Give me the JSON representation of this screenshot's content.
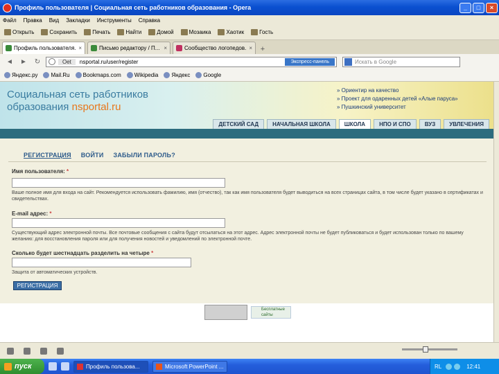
{
  "window": {
    "title": "Профиль пользователя | Социальная сеть работников образования - Opera",
    "min": "_",
    "max": "□",
    "close": "×"
  },
  "menu": [
    "Файл",
    "Правка",
    "Вид",
    "Закладки",
    "Инструменты",
    "Справка"
  ],
  "toolbar": [
    "Открыть",
    "Сохранить",
    "Печать",
    "Найти",
    "Домой",
    "Мозаика",
    "Хаотик",
    "Гость"
  ],
  "tabs": [
    {
      "label": "Профиль пользователя...",
      "close": "×"
    },
    {
      "label": "Письмо редактору / П...",
      "close": "×"
    },
    {
      "label": "Сообщество логопедов...",
      "close": "×"
    }
  ],
  "newtab": "+",
  "address": {
    "back": "◄",
    "forward": "►",
    "reload": "↻",
    "site": "Oet",
    "url": "nsportal.ru/user/register",
    "speed_dial": "Экспресс-панель",
    "search_placeholder": "Искать в Google"
  },
  "bookmarks": [
    "Яндекс.ру",
    "Mail.Ru",
    "Bookmaps.com",
    "Wikipedia",
    "Яндекс",
    "Google"
  ],
  "site": {
    "logo_line1": "Социальная сеть работников",
    "logo_line2_prefix": "образования ",
    "logo_line2_accent": "nsportal.ru",
    "promo": [
      "Ориентир на качество",
      "Проект для одаренных детей «Алые паруса»",
      "Пушкинский университет"
    ],
    "nav": [
      "ДЕТСКИЙ САД",
      "НАЧАЛЬНАЯ ШКОЛА",
      "ШКОЛА",
      "НПО И СПО",
      "ВУЗ",
      "УВЛЕЧЕНИЯ"
    ]
  },
  "form": {
    "tabs": [
      "РЕГИСТРАЦИЯ",
      "ВОЙТИ",
      "ЗАБЫЛИ ПАРОЛЬ?"
    ],
    "username_label": "Имя пользователя:",
    "username_hint": "Ваше полное имя для входа на сайт. Рекомендуется использовать фамилию, имя (отчество), так как имя пользователя будет выводиться на всех страницах сайта, в том числе будет указано в сертификатах и свидетельствах.",
    "email_label": "E-mail адрес:",
    "email_hint": "Существующий адрес электронной почты. Все почтовые сообщения с сайта будут отсылаться на этот адрес. Адрес электронной почты не будет публиковаться и будет использован только по вашему желанию: для восстановления пароля или для получения новостей и уведомлений по электронной почте.",
    "captcha_label": "Сколько будет шестнадцать разделить на четыре",
    "captcha_hint": "Защита от автоматических устройств.",
    "required_mark": "*",
    "submit": "РЕГИСТРАЦИЯ"
  },
  "footer": {
    "badge": "Бесплатные сайты"
  },
  "taskbar": {
    "start": "пуск",
    "tasks": [
      "Профиль пользова...",
      "Microsoft PowerPoint ..."
    ],
    "lang": "RL",
    "clock": "12:41"
  }
}
